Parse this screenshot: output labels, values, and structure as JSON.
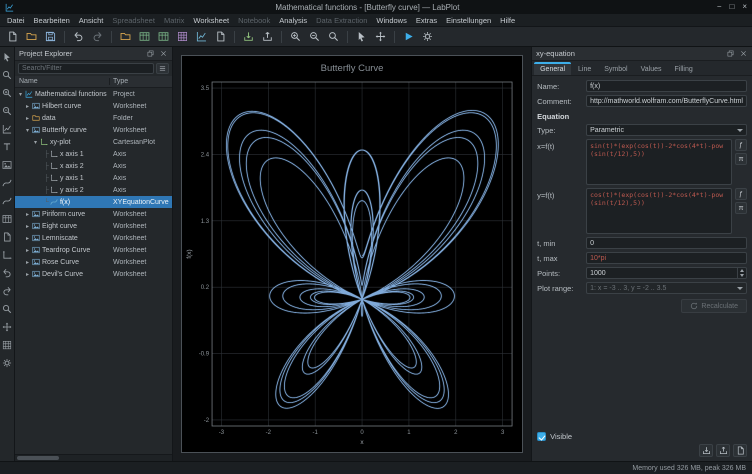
{
  "titlebar": {
    "title": "Mathematical functions - [Butterfly curve] — LabPlot",
    "minimize_glyph": "−",
    "maximize_glyph": "□",
    "close_glyph": "×"
  },
  "menubar": {
    "items": [
      {
        "label": "Datei"
      },
      {
        "label": "Bearbeiten"
      },
      {
        "label": "Ansicht"
      },
      {
        "label": "Spreadsheet",
        "disabled": true
      },
      {
        "label": "Matrix",
        "disabled": true
      },
      {
        "label": "Worksheet"
      },
      {
        "label": "Notebook",
        "disabled": true
      },
      {
        "label": "Analysis"
      },
      {
        "label": "Data Extraction",
        "disabled": true
      },
      {
        "label": "Windows"
      },
      {
        "label": "Extras"
      },
      {
        "label": "Einstellungen"
      },
      {
        "label": "Hilfe"
      }
    ]
  },
  "toolbar": {
    "icon_names": [
      "new-project",
      "open-project",
      "save-project",
      "undo",
      "redo",
      "new-folder",
      "new-workbook",
      "new-spreadsheet",
      "new-matrix",
      "new-worksheet",
      "new-notebook",
      "import-file",
      "export",
      "zoom-in",
      "zoom-out",
      "zoom-fit",
      "select-mode",
      "pan-mode",
      "presenter-mode",
      "configure"
    ]
  },
  "left_toolbar": {
    "icon_names": [
      "select-cursor",
      "zoom-select",
      "zoom-x-select",
      "zoom-y-select",
      "add-plot",
      "add-text-label",
      "add-image",
      "add-curve",
      "add-equation-curve",
      "add-histogram",
      "add-legend",
      "add-axis",
      "shift-left-x",
      "shift-right-x",
      "zoom-fit",
      "navigate",
      "grid-settings",
      "configure"
    ]
  },
  "project_explorer": {
    "title": "Project Explorer",
    "search_placeholder": "Search/Filter",
    "columns": [
      "Name",
      "Type"
    ],
    "rows": [
      {
        "name": "Mathematical functions",
        "type": "Project",
        "depth": 0,
        "arrow": "▾",
        "prefix": "",
        "icon": "project"
      },
      {
        "name": "Hilbert curve",
        "type": "Worksheet",
        "depth": 1,
        "arrow": "▸",
        "prefix": "",
        "icon": "worksheet"
      },
      {
        "name": "data",
        "type": "Folder",
        "depth": 1,
        "arrow": "▸",
        "prefix": "",
        "icon": "folder"
      },
      {
        "name": "Butterfly curve",
        "type": "Worksheet",
        "depth": 1,
        "arrow": "▾",
        "prefix": "",
        "icon": "worksheet"
      },
      {
        "name": "xy-plot",
        "type": "CartesianPlot",
        "depth": 2,
        "arrow": "▾",
        "prefix": "",
        "icon": "plot"
      },
      {
        "name": "x axis 1",
        "type": "Axis",
        "depth": 3,
        "arrow": "",
        "prefix": "├",
        "icon": "axis"
      },
      {
        "name": "x axis 2",
        "type": "Axis",
        "depth": 3,
        "arrow": "",
        "prefix": "├",
        "icon": "axis"
      },
      {
        "name": "y axis 1",
        "type": "Axis",
        "depth": 3,
        "arrow": "",
        "prefix": "├",
        "icon": "axis"
      },
      {
        "name": "y axis 2",
        "type": "Axis",
        "depth": 3,
        "arrow": "",
        "prefix": "├",
        "icon": "axis"
      },
      {
        "name": "f(x)",
        "type": "XYEquationCurve",
        "depth": 3,
        "arrow": "",
        "prefix": "└",
        "icon": "curve",
        "selected": true
      },
      {
        "name": "Piriform curve",
        "type": "Worksheet",
        "depth": 1,
        "arrow": "▸",
        "prefix": "",
        "icon": "worksheet"
      },
      {
        "name": "Eight curve",
        "type": "Worksheet",
        "depth": 1,
        "arrow": "▸",
        "prefix": "",
        "icon": "worksheet"
      },
      {
        "name": "Lemniscate",
        "type": "Worksheet",
        "depth": 1,
        "arrow": "▸",
        "prefix": "",
        "icon": "worksheet"
      },
      {
        "name": "Teardrop Curve",
        "type": "Worksheet",
        "depth": 1,
        "arrow": "▸",
        "prefix": "",
        "icon": "worksheet"
      },
      {
        "name": "Rose Curve",
        "type": "Worksheet",
        "depth": 1,
        "arrow": "▸",
        "prefix": "",
        "icon": "worksheet"
      },
      {
        "name": "Devil's Curve",
        "type": "Worksheet",
        "depth": 1,
        "arrow": "▸",
        "prefix": "",
        "icon": "worksheet"
      }
    ]
  },
  "icon_map": {
    "project": "#i-chart",
    "worksheet": "#i-image",
    "folder": "#i-folder",
    "plot": "#i-axes",
    "axis": "#i-axes",
    "curve": "#i-curve"
  },
  "properties": {
    "dock_title": "xy-equation",
    "tabs": [
      {
        "label": "General",
        "active": true
      },
      {
        "label": "Line"
      },
      {
        "label": "Symbol"
      },
      {
        "label": "Values"
      },
      {
        "label": "Filling"
      }
    ],
    "name_label": "Name:",
    "name_value": "f(x)",
    "comment_label": "Comment:",
    "comment_value": "http://mathworld.wolfram.com/ButterflyCurve.html",
    "equation_section": "Equation",
    "type_label": "Type:",
    "type_value": "Parametric",
    "x_label": "x=f(t)",
    "x_value": "sin(t)*(exp(cos(t))-2*cos(4*t)-pow(sin(t/12),5))",
    "y_label": "y=f(t)",
    "y_value": "cos(t)*(exp(cos(t))-2*cos(4*t)-pow(sin(t/12),5))",
    "fx_button": "ƒ",
    "pi_button": "π",
    "tmin_label": "t, min",
    "tmin_value": "0",
    "tmax_label": "t, max",
    "tmax_value": "10*pi",
    "points_label": "Points:",
    "points_value": "1000",
    "plot_range_label": "Plot range:",
    "plot_range_value": "1: x = -3 .. 3, y = -2 .. 3.5",
    "recalculate_label": "Recalculate",
    "visible_label": "Visible"
  },
  "chart_data": {
    "type": "line",
    "parametric": true,
    "title": "Butterfly Curve",
    "xlabel": "x",
    "ylabel": "f(x)",
    "equation_x": "sin(t)*(exp(cos(t))-2*cos(4*t)-pow(sin(t/12),5))",
    "equation_y": "cos(t)*(exp(cos(t))-2*cos(4*t)-pow(sin(t/12),5))",
    "t_min": 0,
    "t_max": 31.41592653589793,
    "points": 1000,
    "x_range": [
      -3.2,
      3.2
    ],
    "y_range": [
      -2.1,
      3.6
    ],
    "x_ticks": [
      -3,
      -2,
      -1,
      0,
      1,
      2,
      3
    ],
    "y_ticks": [
      3.5,
      2.4,
      1.3,
      0.2,
      -0.9,
      -2
    ],
    "grid": true,
    "legend": false,
    "curve_color": "#85b1e3"
  },
  "statusbar": {
    "memory": "Memory used 326 MB, peak 326 MB"
  }
}
